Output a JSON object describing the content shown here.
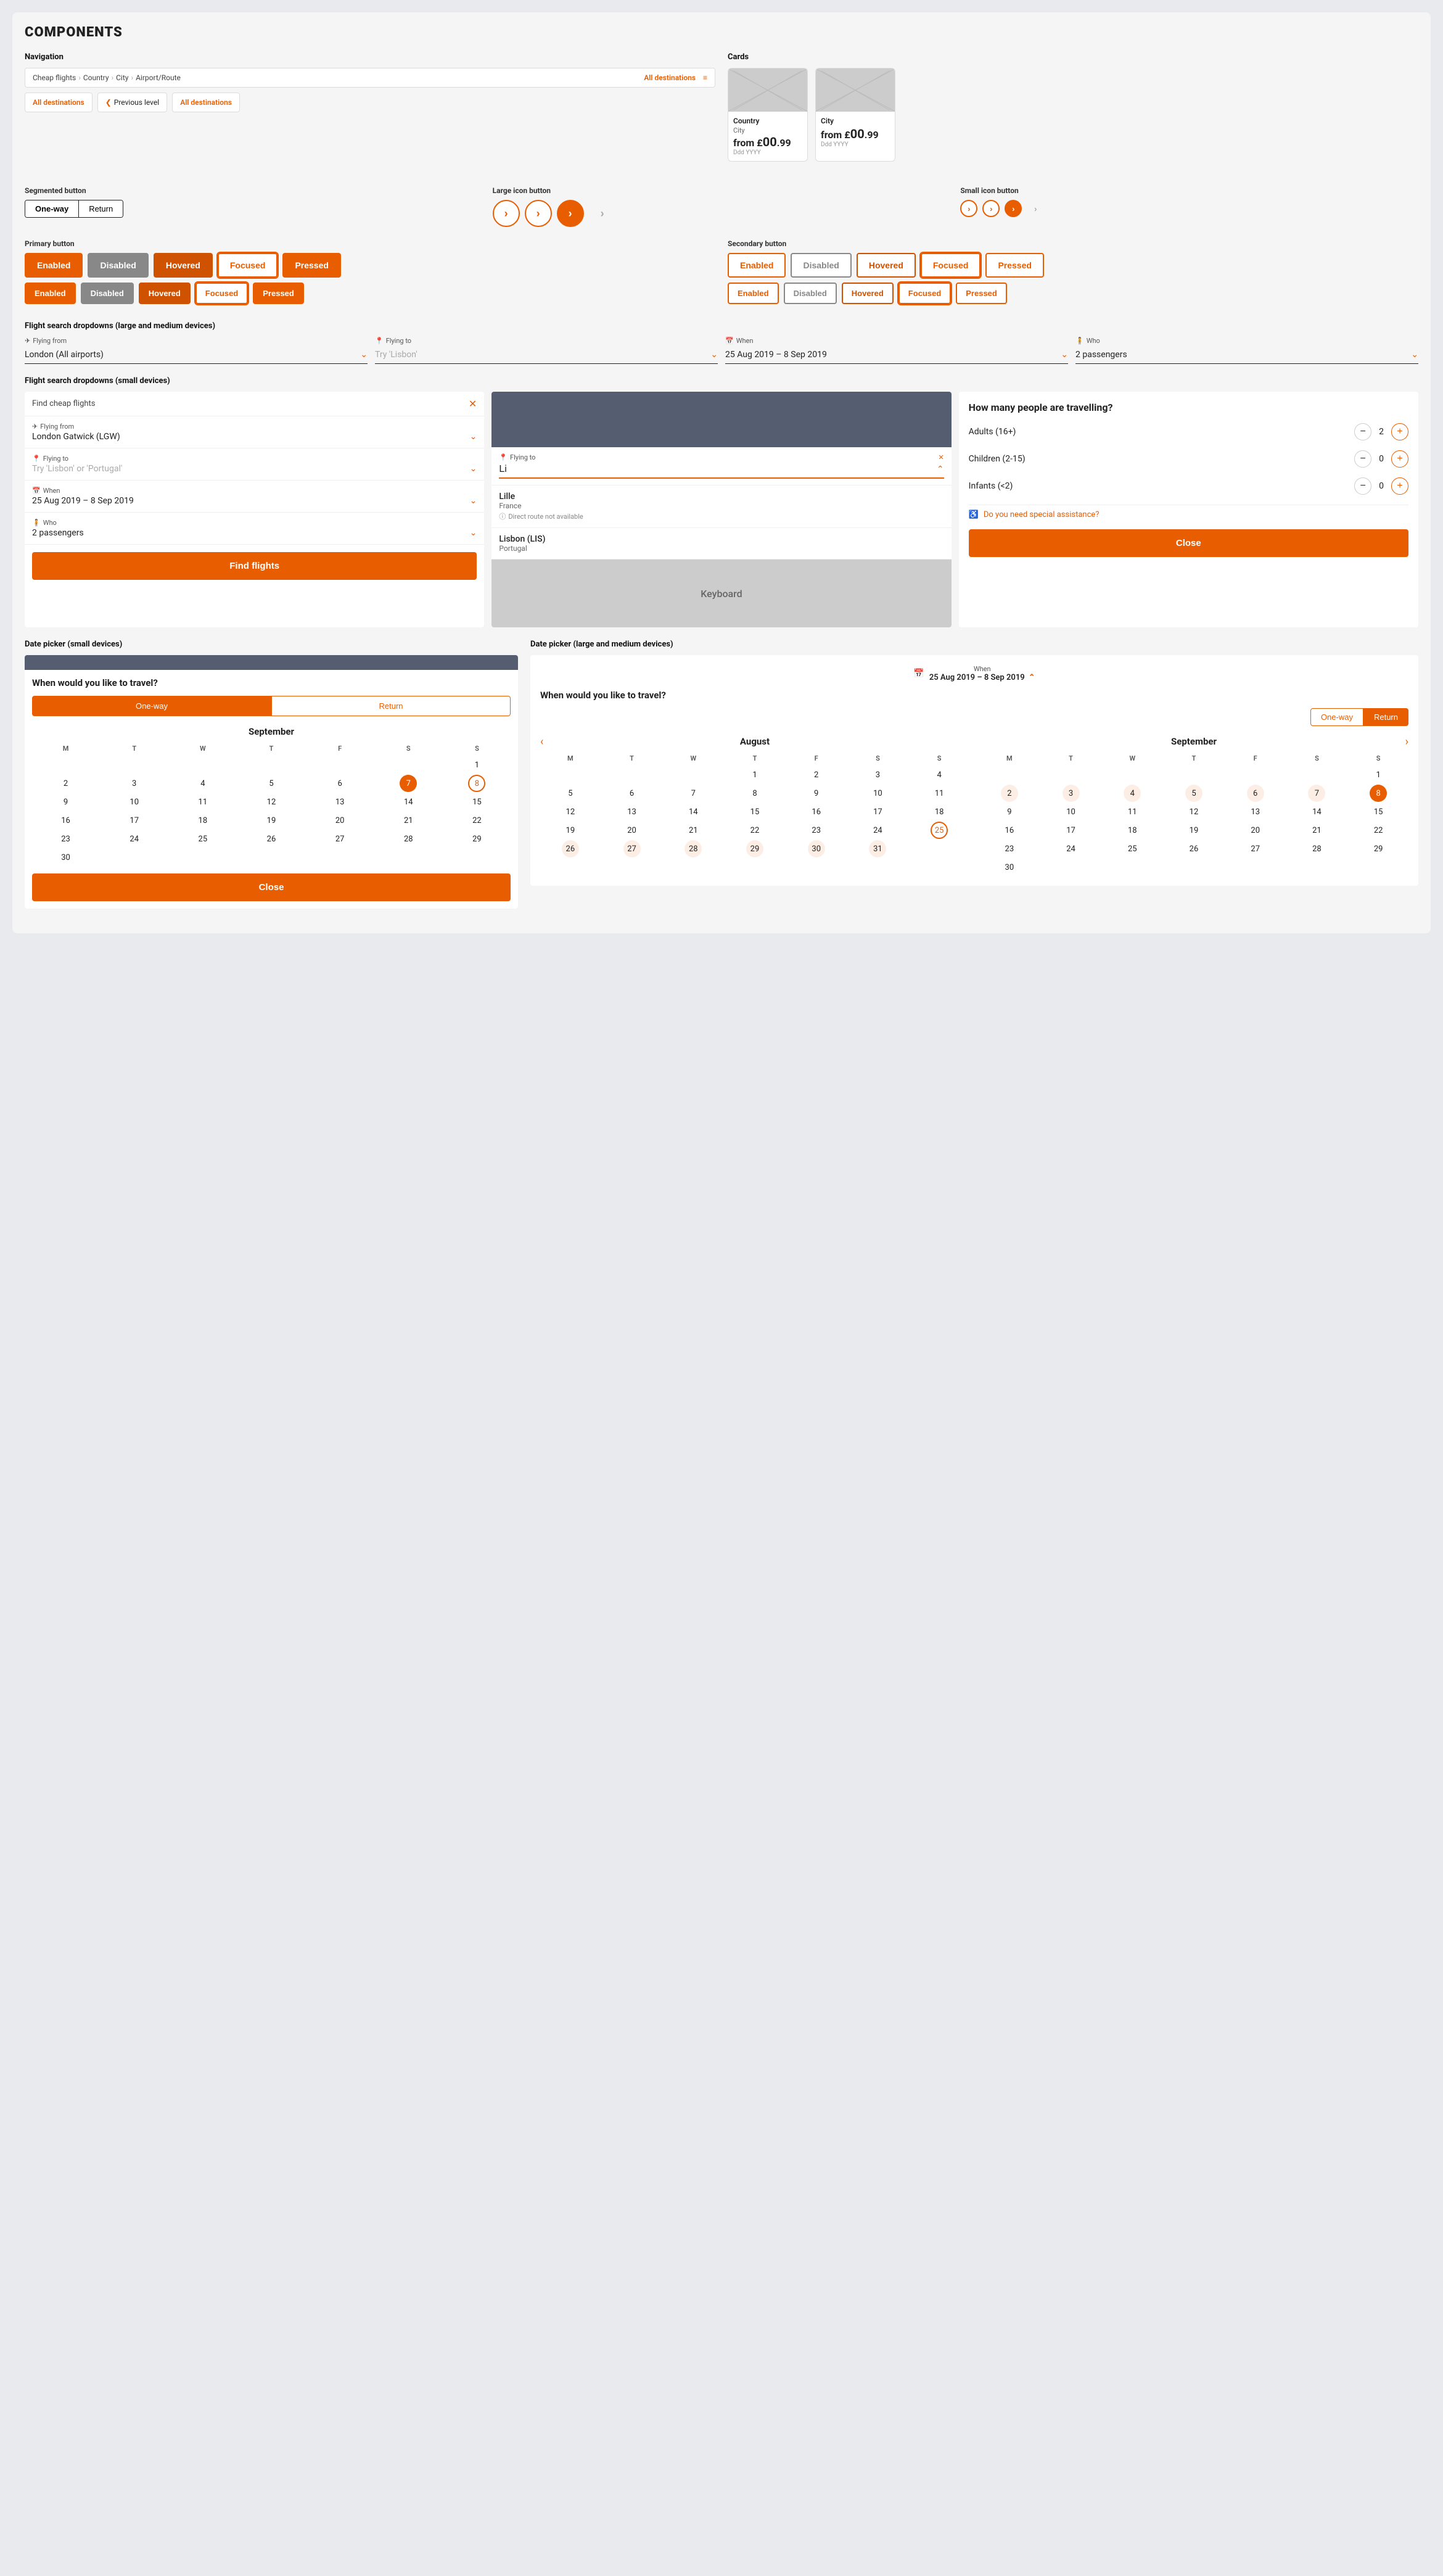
{
  "page": {
    "title": "COMPONENTS"
  },
  "navigation": {
    "label": "Navigation",
    "breadcrumbs": [
      {
        "text": "Cheap flights"
      },
      {
        "text": "Country"
      },
      {
        "text": "City"
      },
      {
        "text": "Airport/Route"
      },
      {
        "text": "All destinations",
        "orange": true
      },
      {
        "text": "≡",
        "orange": true
      }
    ],
    "nav_row2": [
      {
        "text": "All destinations",
        "orange": true
      },
      {
        "text": "❮ Previous level"
      },
      {
        "text": "All destinations",
        "orange": true
      }
    ]
  },
  "cards": {
    "label": "Cards",
    "items": [
      {
        "title": "Country",
        "subtitle": "City",
        "from_label": "from £",
        "price": "00.99",
        "date": "Ddd YYYY"
      },
      {
        "title": "City",
        "from_label": "from £",
        "price": "00.99",
        "date": "Ddd YYYY"
      }
    ]
  },
  "segmented_button": {
    "label": "Segmented button",
    "options": [
      "One-way",
      "Return"
    ],
    "active": "One-way"
  },
  "large_icon_button": {
    "label": "Large icon button"
  },
  "small_icon_button": {
    "label": "Small icon button"
  },
  "primary_button": {
    "label": "Primary button",
    "states": [
      "Enabled",
      "Disabled",
      "Hovered",
      "Focused",
      "Pressed"
    ],
    "states2": [
      "Enabled",
      "Disabled",
      "Hovered",
      "Focused",
      "Pressed"
    ]
  },
  "secondary_button": {
    "label": "Secondary button",
    "states": [
      "Enabled",
      "Disabled",
      "Hovered",
      "Focused",
      "Pressed"
    ],
    "states2": [
      "Enabled",
      "Disabled",
      "Hovered",
      "Focused",
      "Pressed"
    ]
  },
  "flight_search_large": {
    "label": "Flight search dropdowns (large and medium devices)",
    "fields": [
      {
        "icon": "✈",
        "label": "Flying from",
        "value": "London (All airports)"
      },
      {
        "icon": "📍",
        "label": "Flying to",
        "value": "Try 'Lisbon'"
      },
      {
        "icon": "📅",
        "label": "When",
        "value": "25 Aug 2019 – 8 Sep 2019"
      },
      {
        "icon": "🧍",
        "label": "Who",
        "value": "2 passengers"
      }
    ]
  },
  "flight_search_small": {
    "label": "Flight search dropdowns (small devices)",
    "col1": {
      "header": "Find cheap flights",
      "fields": [
        {
          "icon": "✈",
          "label": "Flying from",
          "value": "London Gatwick (LGW)"
        },
        {
          "icon": "📍",
          "label": "Flying to",
          "value": "Try 'Lisbon' or 'Portugal'"
        },
        {
          "icon": "📅",
          "label": "When",
          "value": "25 Aug 2019 – 8 Sep 2019"
        },
        {
          "icon": "🧍",
          "label": "Who",
          "value": "2 passengers"
        }
      ],
      "cta": "Find flights"
    },
    "col2": {
      "label": "Flying to",
      "placeholder": "Li",
      "suggestions": [
        {
          "city": "Lille",
          "country": "France",
          "warning": "Direct route not available"
        },
        {
          "city": "Lisbon (LIS)",
          "country": "Portugal"
        }
      ],
      "keyboard_label": "Keyboard"
    },
    "col3": {
      "title": "How many people are travelling?",
      "passengers": [
        {
          "label": "Adults (16+)",
          "count": 2
        },
        {
          "label": "Children (2-15)",
          "count": 0
        },
        {
          "label": "Infants (<2)",
          "count": 0
        }
      ],
      "special_assist": "Do you need special assistance?",
      "close_btn": "Close"
    }
  },
  "date_picker_small": {
    "label": "Date picker (small devices)",
    "header_label": "",
    "question": "When would you like to travel?",
    "seg_options": [
      "One-way",
      "Return"
    ],
    "active_seg": "One-way",
    "month": "September",
    "days_header": [
      "M",
      "T",
      "W",
      "T",
      "F",
      "S",
      "S"
    ],
    "weeks": [
      [
        null,
        null,
        null,
        null,
        null,
        null,
        "1"
      ],
      [
        "2",
        "3",
        "4",
        "5",
        "6",
        "7",
        "8"
      ],
      [
        "9",
        "10",
        "11",
        "12",
        "13",
        "14",
        "15"
      ],
      [
        "16",
        "17",
        "18",
        "19",
        "20",
        "21",
        "22"
      ],
      [
        "23",
        "24",
        "25",
        "26",
        "27",
        "28",
        "29"
      ],
      [
        "30",
        null,
        null,
        null,
        null,
        null,
        null
      ]
    ],
    "selected_day": "7",
    "circled_day": "8",
    "close_btn": "Close"
  },
  "date_picker_large": {
    "label": "Date picker (large and medium devices)",
    "when_label": "When",
    "when_value": "25 Aug 2019 – 8 Sep 2019",
    "question": "When would you like to travel?",
    "seg_options": [
      "One-way",
      "Return"
    ],
    "active_seg": "Return",
    "august": {
      "month": "August",
      "days_header": [
        "M",
        "T",
        "W",
        "T",
        "F",
        "S",
        "S"
      ],
      "weeks": [
        [
          null,
          null,
          null,
          "1",
          "2",
          "3",
          "4"
        ],
        [
          "5",
          "6",
          "7",
          "8",
          "9",
          "10",
          "11"
        ],
        [
          "12",
          "13",
          "14",
          "15",
          "16",
          "17",
          "18"
        ],
        [
          "19",
          "20",
          "21",
          "22",
          "23",
          "24",
          "25"
        ],
        [
          "26",
          "27",
          "28",
          "29",
          "30",
          "31",
          null
        ]
      ],
      "circled_day": "25"
    },
    "september": {
      "month": "September",
      "days_header": [
        "M",
        "T",
        "W",
        "T",
        "F",
        "S",
        "S"
      ],
      "weeks": [
        [
          null,
          null,
          null,
          null,
          null,
          null,
          "1"
        ],
        [
          "2",
          "3",
          "4",
          "5",
          "6",
          "7",
          "8"
        ],
        [
          "9",
          "10",
          "11",
          "12",
          "13",
          "14",
          "15"
        ],
        [
          "16",
          "17",
          "18",
          "19",
          "20",
          "21",
          "22"
        ],
        [
          "23",
          "24",
          "25",
          "26",
          "27",
          "28",
          "29"
        ],
        [
          "30",
          null,
          null,
          null,
          null,
          null,
          null
        ]
      ],
      "selected_day": "8"
    }
  }
}
